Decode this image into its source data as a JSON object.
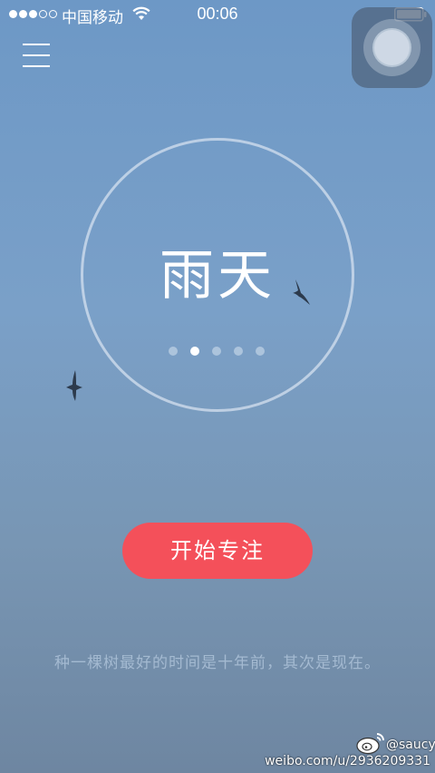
{
  "status_bar": {
    "signal_full": 3,
    "signal_total": 5,
    "carrier": "中国移动",
    "time": "00:06"
  },
  "main": {
    "sound_name": "雨天",
    "page_count": 5,
    "active_page_index": 1,
    "start_button_label": "开始专注",
    "quote": "种一棵树最好的时间是十年前，其次是现在。"
  },
  "watermark": {
    "handle": "@saucy",
    "url": "weibo.com/u/2936209331"
  },
  "colors": {
    "accent": "#f4505a",
    "background_top": "#6d98c6",
    "background_bottom": "#6e86a1"
  },
  "icons": {
    "menu": "hamburger-menu-icon",
    "wifi": "wifi-icon",
    "battery": "battery-icon",
    "assistive": "assistive-touch-icon",
    "bird": "bird-icon",
    "weibo": "weibo-logo-icon"
  }
}
